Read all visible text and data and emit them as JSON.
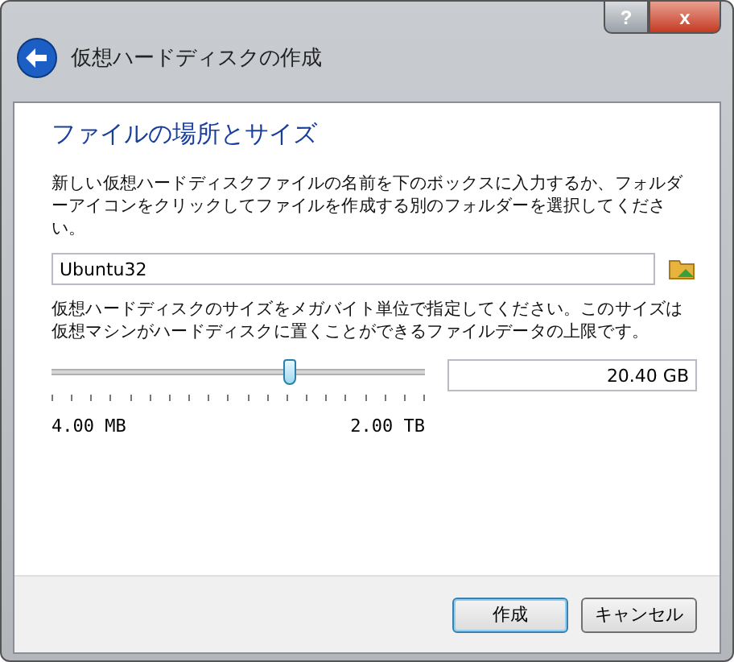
{
  "window": {
    "title": "仮想ハードディスクの作成",
    "help_button": "?",
    "close_button": "x"
  },
  "page": {
    "heading": "ファイルの場所とサイズ",
    "location_text": "新しい仮想ハードディスクファイルの名前を下のボックスに入力するか、フォルダーアイコンをクリックしてファイルを作成する別のフォルダーを選択してください。",
    "file_name": "Ubuntu32",
    "size_text": "仮想ハードディスクのサイズをメガバイト単位で指定してください。このサイズは仮想マシンがハードディスクに置くことができるファイルデータの上限です。",
    "size_slider": {
      "level": 0.64,
      "min_label": "4.00 MB",
      "max_label": "2.00 TB"
    },
    "size_value": "20.40 GB"
  },
  "buttons": [
    {
      "label": "作成",
      "default": true
    },
    {
      "label": "キャンセル",
      "default": false
    }
  ]
}
